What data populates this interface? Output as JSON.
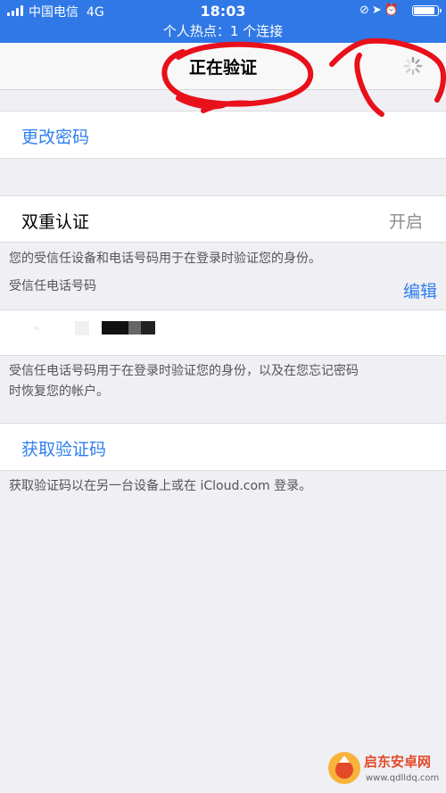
{
  "status_bar": {
    "carrier": "中国电信",
    "network": "4G",
    "time": "18:03",
    "icons": [
      "orientation-lock-icon",
      "location-icon",
      "alarm-icon",
      "battery-icon"
    ],
    "battery_level": 0.9,
    "hotspot_text": "个人热点：1 个连接"
  },
  "nav": {
    "title": "正在验证",
    "activity_icon": "spinner-icon"
  },
  "change_password": {
    "label": "更改密码"
  },
  "two_factor": {
    "label": "双重认证",
    "value": "开启",
    "description": "您的受信任设备和电话号码用于在登录时验证您的身份。"
  },
  "trusted_phone": {
    "header": "受信任电话号码",
    "edit_label": "编辑",
    "note_line1": "受信任电话号码用于在登录时验证您的身份，以及在您忘记密码",
    "note_line2": "时恢复您的帐户。"
  },
  "get_code": {
    "label": "获取验证码",
    "note": "获取验证码以在另一台设备上或在 iCloud.com 登录。"
  },
  "watermark": {
    "name": "启东安卓网",
    "url": "www.qdlldq.com"
  },
  "colors": {
    "status_bar": "#2f78e6",
    "link_blue": "#2f7ff0",
    "annotation_red": "#e8101a",
    "background": "#efeff4"
  }
}
